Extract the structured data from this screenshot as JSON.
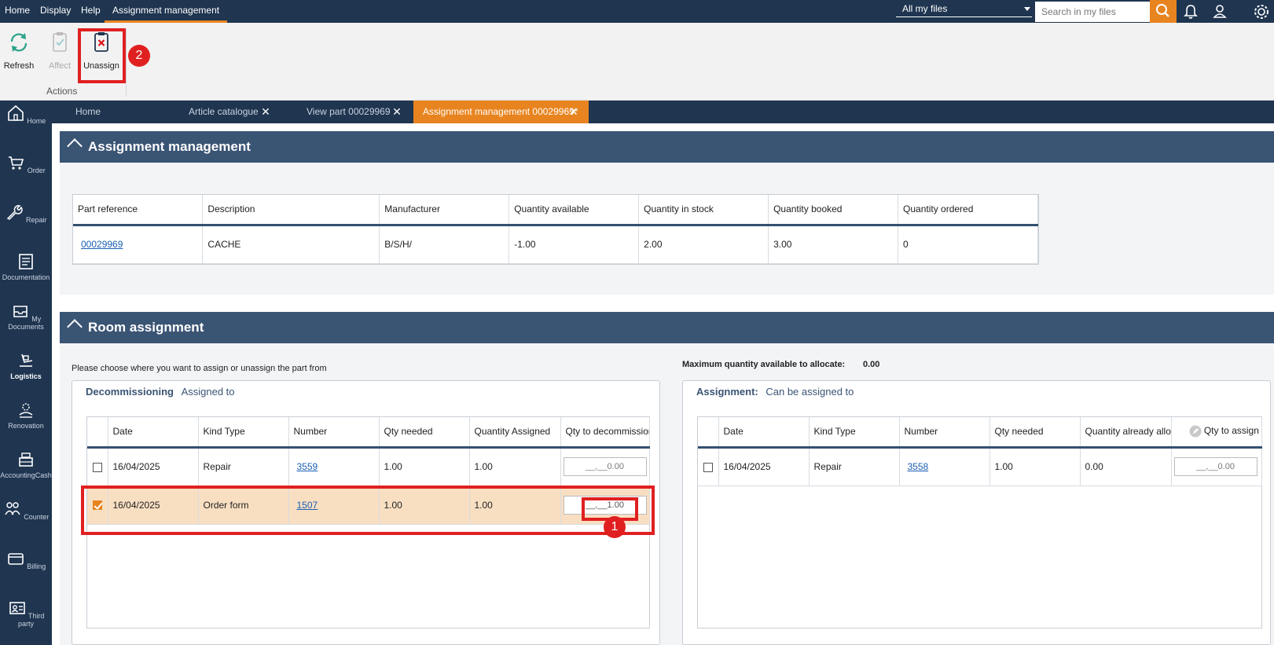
{
  "menu": {
    "items": [
      "Home",
      "Display",
      "Help",
      "Assignment management"
    ],
    "scope_value": "All my files",
    "search_placeholder": "Search in my files"
  },
  "ribbon": {
    "refresh_label": "Refresh",
    "affect_label": "Affect",
    "unassign_label": "Unassign",
    "group_label": "Actions",
    "callout_2": "2"
  },
  "nav": {
    "items": [
      "Home",
      "Order",
      "Repair",
      "Documentation",
      "My Documents",
      "Logistics",
      "Renovation",
      "AccountingCash",
      "Counter",
      "Billing",
      "Third party"
    ]
  },
  "tabs": [
    "Home",
    "Article catalogue",
    "View part 00029969",
    "Assignment management 00029969*"
  ],
  "section1": {
    "title": "Assignment management",
    "columns": [
      "Part reference",
      "Description",
      "Manufacturer",
      "Quantity available",
      "Quantity in stock",
      "Quantity booked",
      "Quantity ordered"
    ],
    "row": [
      "00029969",
      "CACHE",
      "B/S/H/",
      "-1.00",
      "2.00",
      "3.00",
      "0"
    ]
  },
  "section2": {
    "title": "Room assignment",
    "instruction": "Please choose where you want to assign or unassign the part from",
    "max_label": "Maximum quantity available to allocate:",
    "max_value": "0.00",
    "decom": {
      "title_bold": "Decommissioning",
      "title_sub": "Assigned to",
      "columns": [
        "Date",
        "Kind Type",
        "Number",
        "Qty needed",
        "Quantity Assigned",
        "Qty to decommission"
      ],
      "rows": [
        {
          "date": "16/04/2025",
          "kind": "Repair",
          "number": "3559",
          "needed": "1.00",
          "assigned": "1.00",
          "qty": "__,__0.00",
          "checked": false
        },
        {
          "date": "16/04/2025",
          "kind": "Order form",
          "number": "1507",
          "needed": "1.00",
          "assigned": "1.00",
          "qty": "__,__1.00",
          "checked": true
        }
      ],
      "callout_1": "1"
    },
    "assign": {
      "title_bold": "Assignment:",
      "title_sub": "Can be assigned to",
      "columns": [
        "Date",
        "Kind Type",
        "Number",
        "Qty needed",
        "Quantity already alloc",
        "Qty to assign"
      ],
      "rows": [
        {
          "date": "16/04/2025",
          "kind": "Repair",
          "number": "3558",
          "needed": "1.00",
          "allocated": "0.00",
          "qty": "__,__0.00",
          "checked": false
        }
      ]
    }
  },
  "colors": {
    "dark_navy": "#1f3550",
    "section_header": "#3a5474",
    "accent_orange": "#e8841f",
    "callout_red": "#e02020",
    "selected_row": "#f9dfc2"
  }
}
